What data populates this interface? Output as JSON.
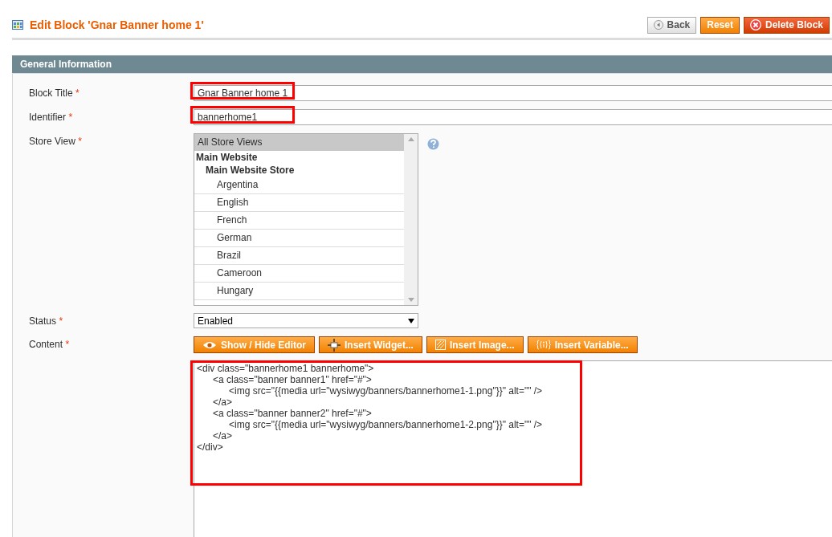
{
  "header": {
    "title": "Edit Block 'Gnar Banner home 1'",
    "buttons": [
      {
        "kind": "back",
        "label": "Back"
      },
      {
        "kind": "reset",
        "label": "Reset"
      },
      {
        "kind": "delete",
        "label": "Delete Block"
      }
    ]
  },
  "section": {
    "title": "General Information"
  },
  "fields": [
    {
      "kind": "text",
      "label": "Block Title",
      "required_mark": "*",
      "value": "Gnar Banner home 1",
      "highlighted": true
    },
    {
      "kind": "text",
      "label": "Identifier",
      "required_mark": "*",
      "value": "bannerhome1",
      "highlighted": true
    },
    {
      "kind": "multiselect",
      "label": "Store View",
      "required_mark": "*",
      "options": [
        {
          "label": "All Store Views",
          "selected": true
        },
        {
          "label": "Main Website",
          "children": [
            {
              "label": "Main Website Store",
              "children": [
                {
                  "label": "Argentina",
                  "selected": false
                },
                {
                  "label": "English",
                  "selected": false
                },
                {
                  "label": "French",
                  "selected": false
                },
                {
                  "label": "German",
                  "selected": false
                },
                {
                  "label": "Brazil",
                  "selected": false
                },
                {
                  "label": "Cameroon",
                  "selected": false
                },
                {
                  "label": "Hungary",
                  "selected": false
                }
              ]
            }
          ]
        }
      ]
    },
    {
      "kind": "select",
      "label": "Status",
      "required_mark": "*",
      "value": "Enabled"
    },
    {
      "kind": "editor",
      "label": "Content",
      "required_mark": "*",
      "buttons": [
        {
          "kind": "eye",
          "label": "Show / Hide Editor"
        },
        {
          "kind": "widget",
          "label": "Insert Widget..."
        },
        {
          "kind": "image",
          "label": "Insert Image..."
        },
        {
          "kind": "variable",
          "label": "Insert Variable..."
        }
      ],
      "value": "<div class=\"bannerhome1 bannerhome\">\n\t<a class=\"banner banner1\" href=\"#\">\n\t\t<img src=\"{{media url=\"wysiwyg/banners/bannerhome1-1.png\"}}\" alt=\"\" />\n\t</a>\n\t<a class=\"banner banner2\" href=\"#\">\n\t\t<img src=\"{{media url=\"wysiwyg/banners/bannerhome1-2.png\"}}\" alt=\"\" />\n\t</a>\n</div>",
      "highlighted": true
    }
  ]
}
